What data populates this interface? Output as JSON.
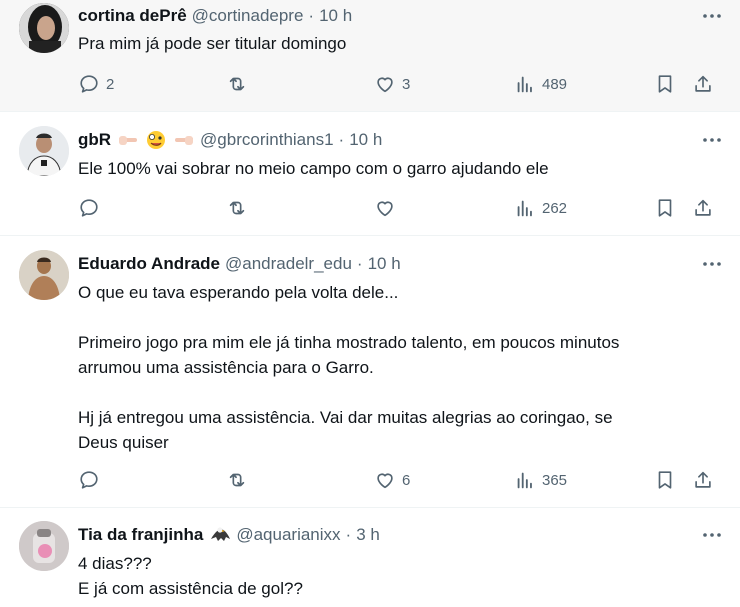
{
  "tweets": [
    {
      "name": "cortina dePrê",
      "handle": "@cortinadepre",
      "dot": "·",
      "time": "10 h",
      "text": "Pra mim já pode ser titular domingo",
      "replies": "2",
      "retweets": "",
      "likes": "3",
      "views": "489"
    },
    {
      "name": "gbR",
      "handle": "@gbrcorinthians1",
      "dot": "·",
      "time": "10 h",
      "text": "Ele 100% vai sobrar no meio campo com o garro ajudando ele",
      "replies": "",
      "retweets": "",
      "likes": "",
      "views": "262",
      "badge_icons": [
        "pointing-right-emoji",
        "zany-face-emoji",
        "pointing-left-emoji"
      ]
    },
    {
      "name": "Eduardo Andrade",
      "handle": "@andradelr_edu",
      "dot": "·",
      "time": "10 h",
      "text": "O que eu tava esperando pela volta dele...\n\nPrimeiro jogo pra mim ele já tinha mostrado talento, em poucos minutos\narrumou uma assistência para o Garro.\n\nHj já entregou uma assistência. Vai dar muitas alegrias ao coringao, se\nDeus quiser",
      "replies": "",
      "retweets": "",
      "likes": "6",
      "views": "365"
    },
    {
      "name": "Tia da franjinha",
      "handle": "@aquarianixx",
      "dot": "·",
      "time": "3 h",
      "text": "4 dias???\nE já com assistência de gol??",
      "badge_icons": [
        "eagle-emoji"
      ]
    }
  ],
  "colors": {
    "text": "#0f1419",
    "secondary": "#536471",
    "hover_bg": "#f7f7f7",
    "divider": "#eff3f4"
  }
}
